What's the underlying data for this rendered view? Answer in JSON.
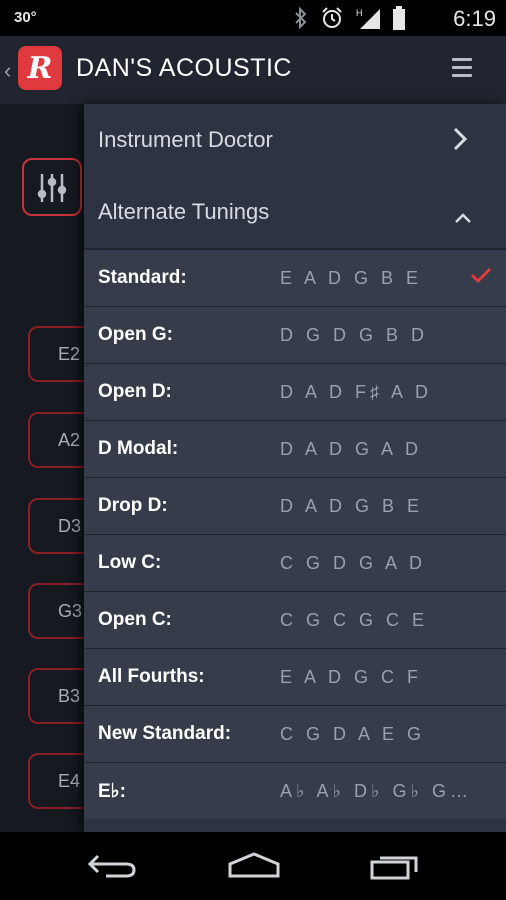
{
  "status": {
    "temperature": "30°",
    "time": "6:19",
    "icons": [
      "bluetooth-icon",
      "alarm-icon",
      "signal-icon",
      "battery-icon"
    ]
  },
  "appbar": {
    "title": "DAN'S ACOUSTIC",
    "logo_letter": "R",
    "brand_color": "#e03a3e"
  },
  "background": {
    "string_buttons": [
      "E2",
      "A2",
      "D3",
      "G3",
      "B3",
      "E4"
    ]
  },
  "drawer": {
    "sections": [
      {
        "label": "Instrument Doctor",
        "icon": "chevron-right-icon"
      },
      {
        "label": "Alternate Tunings",
        "icon": "chevron-up-icon"
      }
    ],
    "tunings": [
      {
        "name": "Standard:",
        "notes": "E A D G B E",
        "selected": true
      },
      {
        "name": "Open G:",
        "notes": "D G D G B D",
        "selected": false
      },
      {
        "name": "Open D:",
        "notes": "D A D F♯ A D",
        "selected": false
      },
      {
        "name": "D Modal:",
        "notes": "D A D G A D",
        "selected": false
      },
      {
        "name": "Drop D:",
        "notes": "D A D G B E",
        "selected": false
      },
      {
        "name": "Low C:",
        "notes": "C G D G A D",
        "selected": false
      },
      {
        "name": "Open C:",
        "notes": "C G C G C E",
        "selected": false
      },
      {
        "name": "All Fourths:",
        "notes": "E A D G C F",
        "selected": false
      },
      {
        "name": "New Standard:",
        "notes": "C G D A E G",
        "selected": false
      },
      {
        "name": "E♭:",
        "notes": "A♭ A♭ D♭ G♭ G…",
        "selected": false
      }
    ]
  },
  "navbar": {
    "icons": [
      "back-icon",
      "home-icon",
      "recents-icon"
    ]
  }
}
